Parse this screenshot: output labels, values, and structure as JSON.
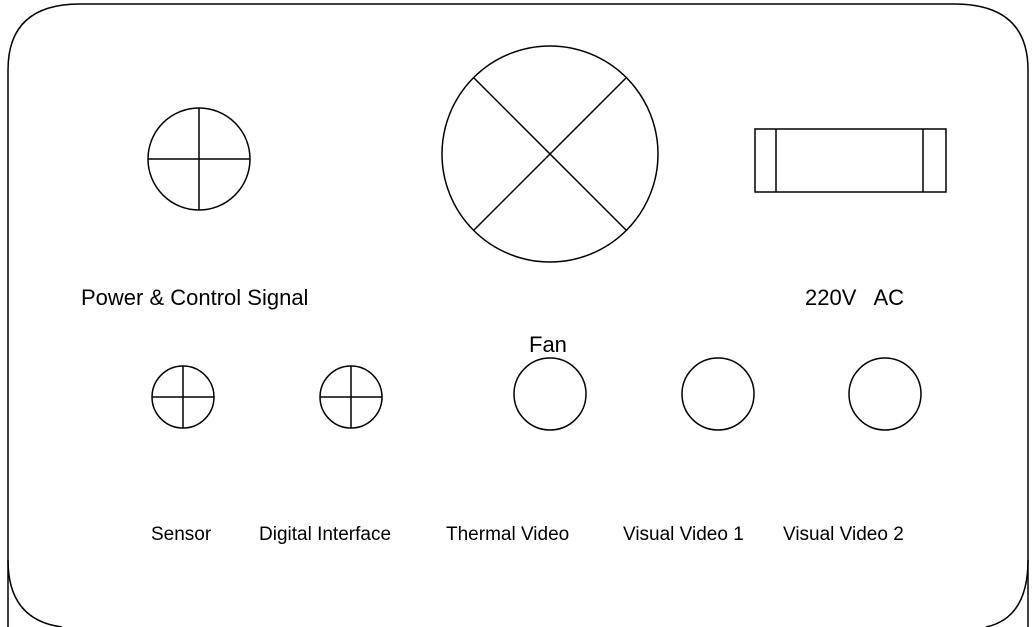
{
  "labels": {
    "power_control": "Power & Control Signal",
    "ac": "220V   AC",
    "fan": "Fan",
    "sensor": "Sensor",
    "digital_interface": "Digital Interface",
    "thermal_video": "Thermal Video",
    "visual_video_1": "Visual Video 1",
    "visual_video_2": "Visual Video 2"
  },
  "colors": {
    "stroke": "#000000",
    "background": "#ffffff"
  }
}
